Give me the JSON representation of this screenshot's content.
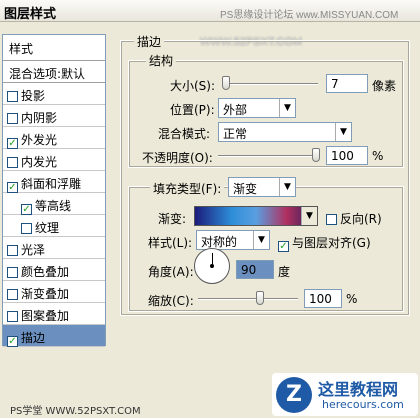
{
  "window": {
    "title": "图层样式",
    "watermark_top": "PS思缘设计论坛  www.MISSYUAN.COM",
    "watermark_url": "WWW.52PSXT.COM",
    "watermark_bottom": "PS学堂 WWW.52PSXT.COM"
  },
  "left_panel": {
    "header": "样式",
    "blend_options": "混合选项:默认",
    "items": [
      {
        "label": "投影",
        "checked": false
      },
      {
        "label": "内阴影",
        "checked": false
      },
      {
        "label": "外发光",
        "checked": true
      },
      {
        "label": "内发光",
        "checked": false
      },
      {
        "label": "斜面和浮雕",
        "checked": true
      },
      {
        "label": "等高线",
        "checked": true
      },
      {
        "label": "纹理",
        "checked": false
      },
      {
        "label": "光泽",
        "checked": false
      },
      {
        "label": "颜色叠加",
        "checked": false
      },
      {
        "label": "渐变叠加",
        "checked": false
      },
      {
        "label": "图案叠加",
        "checked": false
      },
      {
        "label": "描边",
        "checked": true
      }
    ]
  },
  "stroke": {
    "section_title": "描边",
    "structure_title": "结构",
    "size_label": "大小(S):",
    "size_value": "7",
    "size_unit": "像素",
    "position_label": "位置(P):",
    "position_value": "外部",
    "blend_label": "混合模式:",
    "blend_value": "正常",
    "opacity_label": "不透明度(O):",
    "opacity_value": "100",
    "opacity_unit": "%",
    "fill_type_label": "填充类型(F):",
    "fill_type_value": "渐变",
    "gradient_label": "渐变:",
    "reverse_label": "反向(R)",
    "style_label": "样式(L):",
    "style_value": "对称的",
    "align_label": "与图层对齐(G)",
    "angle_label": "角度(A):",
    "angle_value": "90",
    "angle_unit": "度",
    "scale_label": "缩放(C):",
    "scale_value": "100",
    "scale_unit": "%"
  },
  "logo": {
    "title": "这里教程网",
    "url": "herecours.com"
  },
  "colors": {
    "selected": "#6b8fbf",
    "gradient": [
      "#1c1c7a",
      "#2d8ed8",
      "#b03060",
      "#1e1a5c"
    ]
  }
}
